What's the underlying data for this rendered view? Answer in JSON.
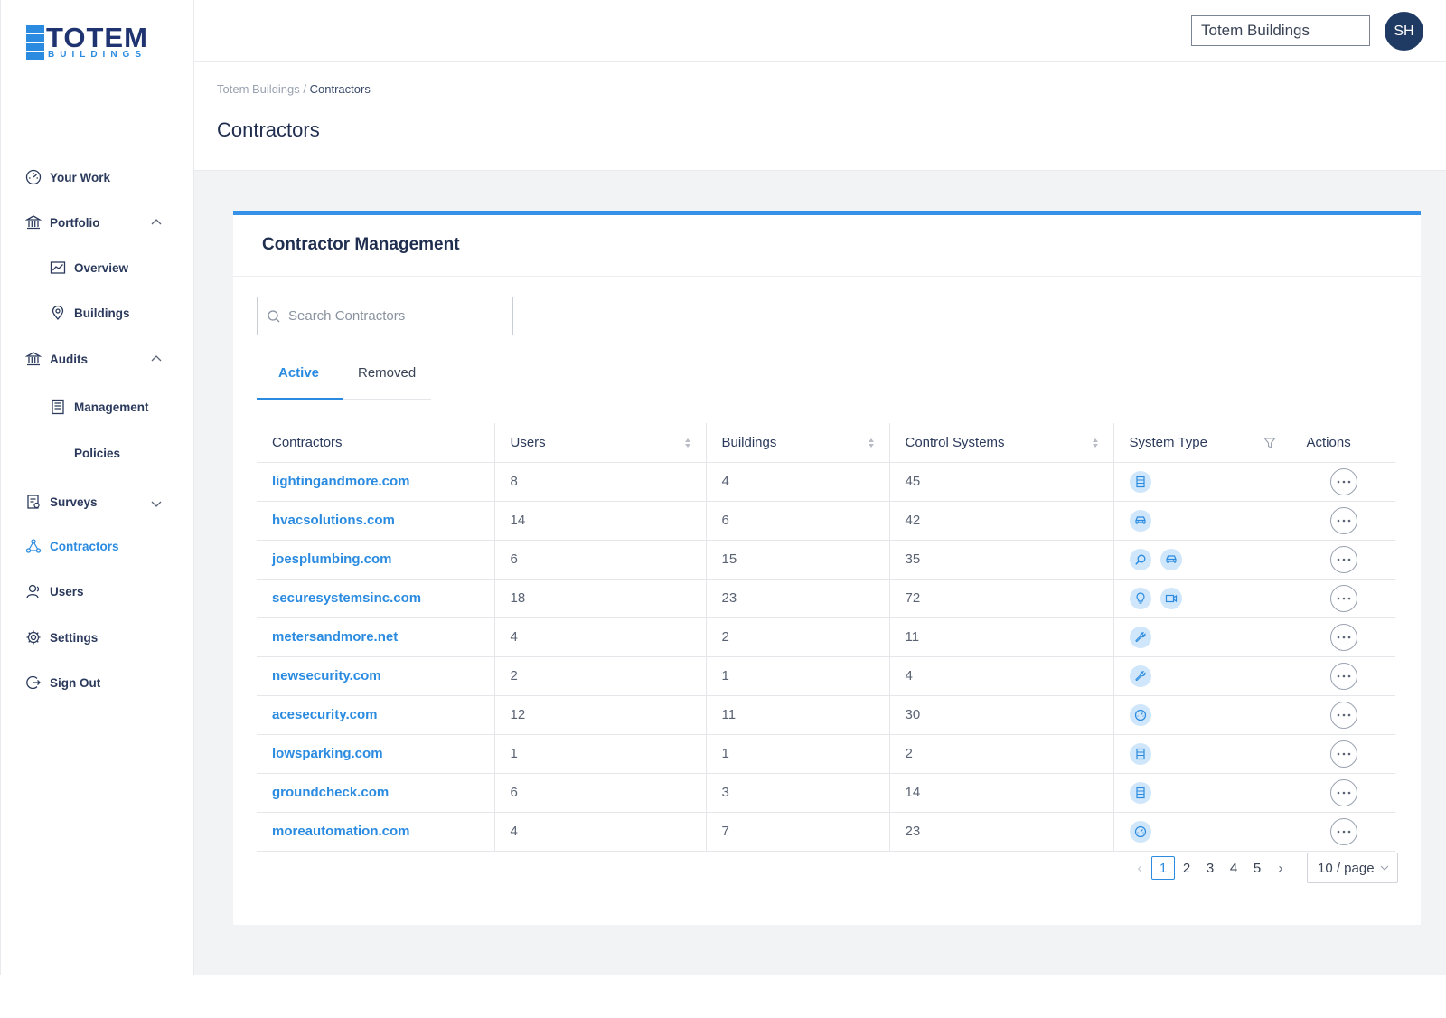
{
  "brand": {
    "name": "TOTEM",
    "sub": "BUILDINGS",
    "mark": "™"
  },
  "header": {
    "org": "Totem Buildings",
    "avatar_initials": "SH"
  },
  "sidebar": {
    "items": [
      {
        "label": "Your Work",
        "icon": "gauge-icon"
      },
      {
        "label": "Portfolio",
        "icon": "bank-icon",
        "expanded": true
      },
      {
        "label": "Overview",
        "icon": "chart-icon"
      },
      {
        "label": "Buildings",
        "icon": "location-pin-icon"
      },
      {
        "label": "Audits",
        "icon": "bank-icon",
        "expanded": true
      },
      {
        "label": "Management",
        "icon": "document-icon"
      },
      {
        "label": "Policies",
        "icon": ""
      },
      {
        "label": "Surveys",
        "icon": "clipboard-icon",
        "expanded": false
      },
      {
        "label": "Contractors",
        "icon": "network-icon",
        "active": true
      },
      {
        "label": "Users",
        "icon": "user-icon"
      },
      {
        "label": "Settings",
        "icon": "gear-icon"
      },
      {
        "label": "Sign Out",
        "icon": "sign-out-icon"
      }
    ]
  },
  "breadcrumb": {
    "root": "Totem Buildings",
    "sep": " / ",
    "current": "Contractors"
  },
  "page_title": "Contractors",
  "card": {
    "title": "Contractor Management",
    "search_placeholder": "Search Contractors",
    "tabs": [
      "Active",
      "Removed"
    ],
    "active_tab": "Active"
  },
  "table": {
    "columns": [
      "Contractors",
      "Users",
      "Buildings",
      "Control Systems",
      "System Type",
      "Actions"
    ],
    "rows": [
      {
        "name": "lightingandmore.com",
        "users": "8",
        "buildings": "4",
        "control": "45",
        "types": [
          "server-icon"
        ]
      },
      {
        "name": "hvacsolutions.com",
        "users": "14",
        "buildings": "6",
        "control": "42",
        "types": [
          "car-icon"
        ]
      },
      {
        "name": "joesplumbing.com",
        "users": "6",
        "buildings": "15",
        "control": "35",
        "types": [
          "search-icon",
          "car-icon"
        ]
      },
      {
        "name": "securesystemsinc.com",
        "users": "18",
        "buildings": "23",
        "control": "72",
        "types": [
          "bulb-icon",
          "video-icon"
        ]
      },
      {
        "name": "metersandmore.net",
        "users": "4",
        "buildings": "2",
        "control": "11",
        "types": [
          "wrench-icon"
        ]
      },
      {
        "name": "newsecurity.com",
        "users": "2",
        "buildings": "1",
        "control": "4",
        "types": [
          "wrench-icon"
        ]
      },
      {
        "name": "acesecurity.com",
        "users": "12",
        "buildings": "11",
        "control": "30",
        "types": [
          "gauge-icon"
        ]
      },
      {
        "name": "lowsparking.com",
        "users": "1",
        "buildings": "1",
        "control": "2",
        "types": [
          "server-icon"
        ]
      },
      {
        "name": "groundcheck.com",
        "users": "6",
        "buildings": "3",
        "control": "14",
        "types": [
          "server-icon"
        ]
      },
      {
        "name": "moreautomation.com",
        "users": "4",
        "buildings": "7",
        "control": "23",
        "types": [
          "gauge-icon"
        ]
      }
    ]
  },
  "pagination": {
    "pages": [
      "1",
      "2",
      "3",
      "4",
      "5"
    ],
    "current": "1",
    "page_size": "10 / page"
  },
  "colors": {
    "accent": "#2a8be0",
    "navy": "#1f3a63",
    "icon_bg": "#cfe6fb"
  }
}
